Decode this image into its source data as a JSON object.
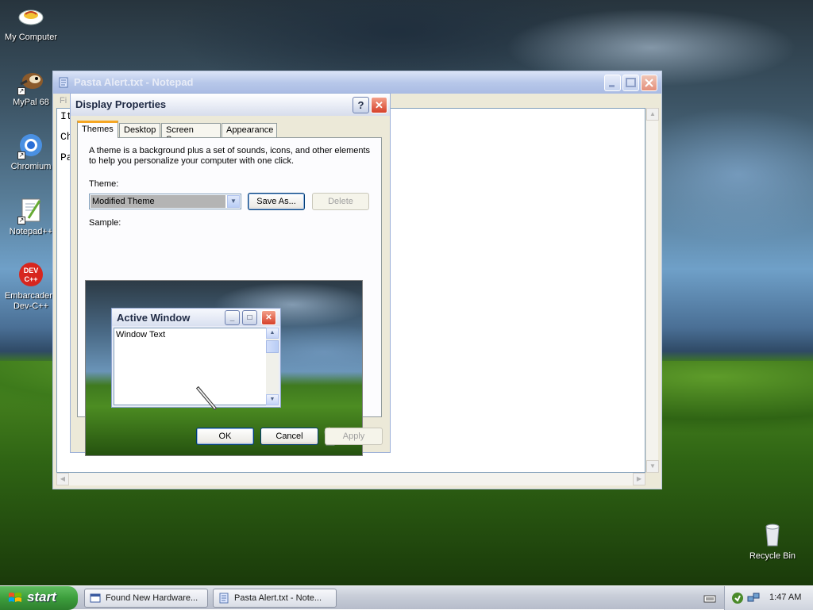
{
  "desktop": {
    "icons": [
      {
        "label": "My Computer"
      },
      {
        "label": "MyPal 68"
      },
      {
        "label": "Chromium"
      },
      {
        "label": "Notepad++"
      },
      {
        "label": "Embarcadero Dev-C++"
      },
      {
        "label": "Recycle Bin"
      }
    ]
  },
  "notepad": {
    "title": "Pasta Alert.txt - Notepad",
    "menu_first": "Fi",
    "lines": [
      "It",
      "Ch",
      "Pa"
    ]
  },
  "display_properties": {
    "title": "Display Properties",
    "help_label": "?",
    "close_label": "✕",
    "tabs": [
      "Themes",
      "Desktop",
      "Screen Saver",
      "Appearance"
    ],
    "description": "A theme is a background plus a set of sounds, icons, and other elements to help you personalize your computer with one click.",
    "theme_label": "Theme:",
    "theme_value": "Modified Theme",
    "save_as_label": "Save As...",
    "delete_label": "Delete",
    "sample_label": "Sample:",
    "sample_window": {
      "title": "Active Window",
      "text": "Window Text"
    },
    "ok_label": "OK",
    "cancel_label": "Cancel",
    "apply_label": "Apply"
  },
  "taskbar": {
    "start_label": "start",
    "items": [
      {
        "label": "Found New Hardware..."
      },
      {
        "label": "Pasta Alert.txt - Note..."
      }
    ],
    "clock": "1:47 AM"
  },
  "colors": {
    "start_green": "#3c9e3c",
    "close_red": "#d6402a",
    "tab_accent": "#f5a623"
  }
}
